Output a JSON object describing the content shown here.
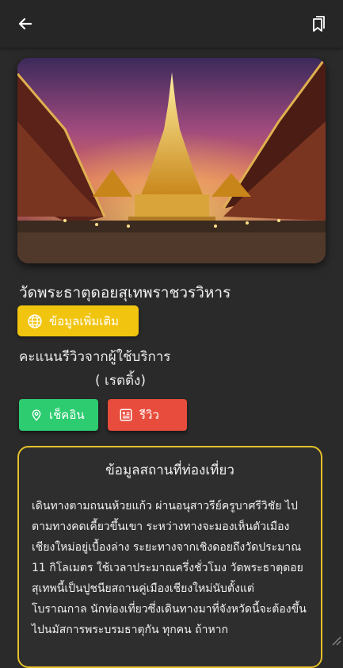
{
  "topbar": {
    "back_icon": "arrow-left-icon",
    "bookmark_icon": "bookmarks-icon"
  },
  "place": {
    "title": "วัดพระธาตุดอยสุเทพราชวรวิหาร",
    "image_alt": "temple-golden-pagoda-photo",
    "more_info_label": "ข้อมูลเพิ่มเติม",
    "more_info_icon": "globe-icon",
    "review_score_label": "คะแนนรีวิวจากผู้ใช้บริการ",
    "rating_text": "( เรตติ้ง)"
  },
  "actions": {
    "checkin_label": "เช็คอิน",
    "checkin_icon": "map-pin-icon",
    "checkin_color": "#2ecc71",
    "review_label": "รีวิว",
    "review_icon": "document-icon",
    "review_color": "#e74c3c"
  },
  "info": {
    "card_title": "ข้อมูลสถานที่ท่องเที่ยว",
    "description": "เดินทางตามถนนห้วยแก้ว ผ่านอนุสาวรีย์ครูบาศรีวิชัย ไปตามทางคดเคี้ยวขึ้นเขา ระหว่างทางจะมองเห็นตัวเมืองเชียงใหม่อยู่เบื้องล่าง ระยะทางจากเชิงดอยถึงวัดประมาณ 11 กิโลเมตร ใช้เวลาประมาณครึ่งชั่วโมง วัดพระธาตุดอยสุเทพนี้เป็นปูชนียสถานคู่เมืองเชียงใหม่นับตั้งแต่โบราณกาล นักท่องเที่ยวซึ่งเดินทางมาที่จังหวัดนี้จะต้องขึ้นไปนมัสการพระบรมธาตุกัน ทุกคน ถ้าหาก"
  },
  "colors": {
    "accent_yellow": "#f1c40f",
    "card_border": "#e6c02a",
    "background": "#2a2a2a"
  }
}
